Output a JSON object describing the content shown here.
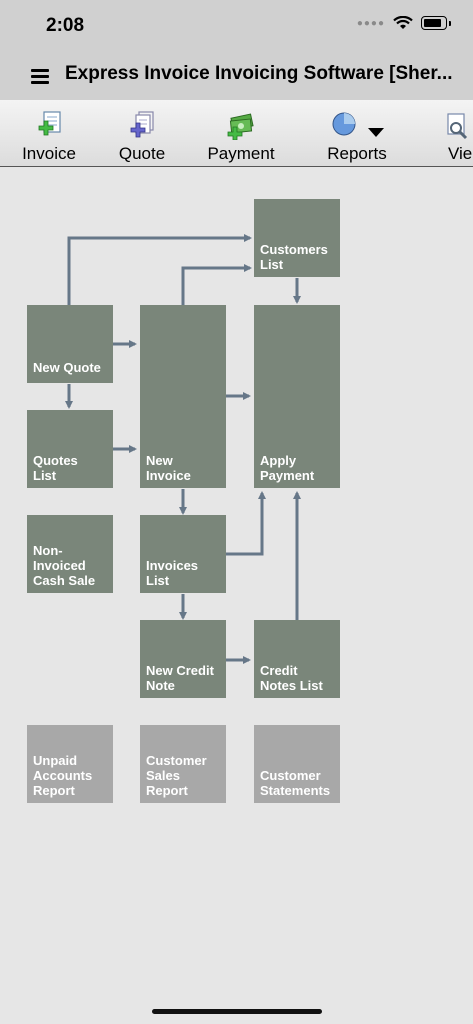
{
  "status": {
    "time": "2:08"
  },
  "header": {
    "title": "Express Invoice Invoicing Software [Sher..."
  },
  "toolbar": {
    "invoice": "Invoice",
    "quote": "Quote",
    "payment": "Payment",
    "reports": "Reports",
    "view": "Vie"
  },
  "flow": {
    "customers_list": [
      "Customers",
      "List"
    ],
    "new_quote": [
      "New Quote"
    ],
    "new_invoice": [
      "New",
      "Invoice"
    ],
    "apply_payment": [
      "Apply",
      "Payment"
    ],
    "quotes_list": [
      "Quotes",
      "List"
    ],
    "non_invoiced_cash_sale": [
      "Non-",
      "Invoiced",
      "Cash Sale"
    ],
    "invoices_list": [
      "Invoices",
      "List"
    ],
    "new_credit_note": [
      "New Credit",
      "Note"
    ],
    "credit_notes_list": [
      "Credit",
      "Notes List"
    ],
    "unpaid_accounts_report": [
      "Unpaid",
      "Accounts",
      "Report"
    ],
    "customer_sales_report": [
      "Customer",
      "Sales",
      "Report"
    ],
    "customer_statements": [
      "Customer",
      "Statements"
    ]
  },
  "colors": {
    "box": "#7a867a",
    "report_box": "#a8a8a8",
    "arrow": "#667788",
    "background": "#e6e6e6"
  }
}
